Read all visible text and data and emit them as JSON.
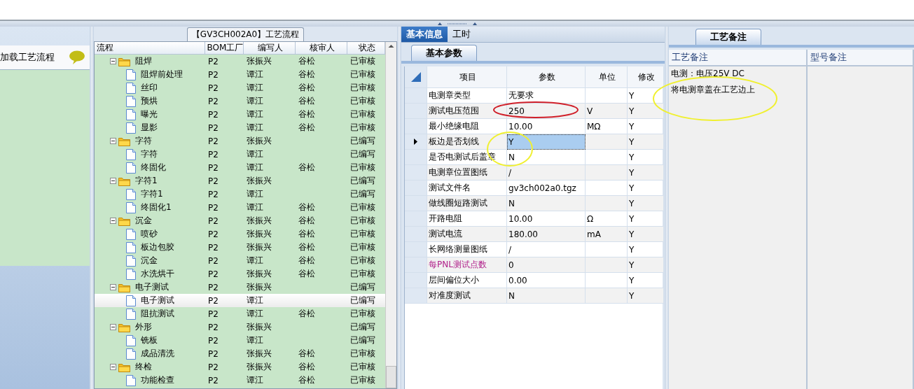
{
  "left_panel": {
    "item": "加载工艺流程"
  },
  "process_tree": {
    "title": "【GV3CH002A0】工艺流程",
    "columns": [
      "流程",
      "BOM工厂",
      "编写人",
      "核审人",
      "状态"
    ],
    "groups": [
      {
        "name": "阻焊",
        "bom": "P2",
        "author": "张振兴",
        "reviewer": "谷松",
        "status": "已审核",
        "expanded": true,
        "children": [
          {
            "name": "阻焊前处理",
            "bom": "P2",
            "author": "谭江",
            "reviewer": "谷松",
            "status": "已审核",
            "selected": false
          },
          {
            "name": "丝印",
            "bom": "P2",
            "author": "谭江",
            "reviewer": "谷松",
            "status": "已审核",
            "selected": false
          },
          {
            "name": "预烘",
            "bom": "P2",
            "author": "谭江",
            "reviewer": "谷松",
            "status": "已审核",
            "selected": false
          },
          {
            "name": "曝光",
            "bom": "P2",
            "author": "谭江",
            "reviewer": "谷松",
            "status": "已审核",
            "selected": false
          },
          {
            "name": "显影",
            "bom": "P2",
            "author": "谭江",
            "reviewer": "谷松",
            "status": "已审核",
            "selected": false
          }
        ]
      },
      {
        "name": "字符",
        "bom": "P2",
        "author": "张振兴",
        "status": "已编写",
        "expanded": true,
        "children": [
          {
            "name": "字符",
            "bom": "P2",
            "author": "谭江",
            "status": "已编写",
            "selected": false
          },
          {
            "name": "终固化",
            "bom": "P2",
            "author": "谭江",
            "reviewer": "谷松",
            "status": "已审核",
            "selected": false
          }
        ]
      },
      {
        "name": "字符1",
        "bom": "P2",
        "author": "张振兴",
        "status": "已编写",
        "expanded": true,
        "children": [
          {
            "name": "字符1",
            "bom": "P2",
            "author": "谭江",
            "status": "已编写",
            "selected": false
          },
          {
            "name": "终固化1",
            "bom": "P2",
            "author": "谭江",
            "reviewer": "谷松",
            "status": "已审核",
            "selected": false
          }
        ]
      },
      {
        "name": "沉金",
        "bom": "P2",
        "author": "张振兴",
        "reviewer": "谷松",
        "status": "已审核",
        "expanded": true,
        "children": [
          {
            "name": "喷砂",
            "bom": "P2",
            "author": "张振兴",
            "reviewer": "谷松",
            "status": "已审核",
            "selected": false
          },
          {
            "name": "板边包胶",
            "bom": "P2",
            "author": "张振兴",
            "reviewer": "谷松",
            "status": "已审核",
            "selected": false
          },
          {
            "name": "沉金",
            "bom": "P2",
            "author": "谭江",
            "reviewer": "谷松",
            "status": "已审核",
            "selected": false
          },
          {
            "name": "水洗烘干",
            "bom": "P2",
            "author": "张振兴",
            "reviewer": "谷松",
            "status": "已审核",
            "selected": false
          }
        ]
      },
      {
        "name": "电子测试",
        "bom": "P2",
        "author": "张振兴",
        "status": "已编写",
        "expanded": true,
        "children": [
          {
            "name": "电子测试",
            "bom": "P2",
            "author": "谭江",
            "status": "已编写",
            "selected": true
          },
          {
            "name": "阻抗测试",
            "bom": "P2",
            "author": "谭江",
            "reviewer": "谷松",
            "status": "已审核",
            "selected": false
          }
        ]
      },
      {
        "name": "外形",
        "bom": "P2",
        "author": "张振兴",
        "status": "已编写",
        "expanded": true,
        "children": [
          {
            "name": "铣板",
            "bom": "P2",
            "author": "谭江",
            "status": "已编写",
            "selected": false
          },
          {
            "name": "成品清洗",
            "bom": "P2",
            "author": "张振兴",
            "reviewer": "谷松",
            "status": "已审核",
            "selected": false
          }
        ]
      },
      {
        "name": "终检",
        "bom": "P2",
        "author": "张振兴",
        "reviewer": "谷松",
        "status": "已审核",
        "expanded": true,
        "children": [
          {
            "name": "功能检查",
            "bom": "P2",
            "author": "谭江",
            "reviewer": "谷松",
            "status": "已审核",
            "selected": false
          }
        ]
      }
    ]
  },
  "info_tabs": [
    {
      "label": "基本信息",
      "selected": true
    },
    {
      "label": "工时",
      "selected": false
    }
  ],
  "params": {
    "tab": "基本参数",
    "columns": [
      "项目",
      "参数",
      "单位",
      "修改"
    ],
    "rows": [
      {
        "item": "电测章类型",
        "value": "无要求",
        "modify": "Y",
        "selected": false,
        "flagged": false
      },
      {
        "item": "测试电压范围",
        "value": "250",
        "unit": "V",
        "modify": "Y",
        "selected": false,
        "flagged": false
      },
      {
        "item": "最小绝缘电阻",
        "value": "10.00",
        "unit": "MΩ",
        "modify": "Y",
        "selected": false,
        "flagged": false
      },
      {
        "item": "板边是否划线",
        "value": "Y",
        "modify": "Y",
        "selected": true,
        "flagged": false
      },
      {
        "item": "是否电测试后盖章",
        "value": "N",
        "modify": "Y",
        "selected": false,
        "flagged": false
      },
      {
        "item": "电测章位置图纸",
        "value": "/",
        "modify": "Y",
        "selected": false,
        "flagged": false
      },
      {
        "item": "测试文件名",
        "value": "gv3ch002a0.tgz",
        "modify": "Y",
        "selected": false,
        "flagged": false
      },
      {
        "item": "做线圈短路测试",
        "value": "N",
        "modify": "Y",
        "selected": false,
        "flagged": false
      },
      {
        "item": "开路电阻",
        "value": "10.00",
        "unit": "Ω",
        "modify": "Y",
        "selected": false,
        "flagged": false
      },
      {
        "item": "测试电流",
        "value": "180.00",
        "unit": "mA",
        "modify": "Y",
        "selected": false,
        "flagged": false
      },
      {
        "item": "长网络测量图纸",
        "value": "/",
        "modify": "Y",
        "selected": false,
        "flagged": false
      },
      {
        "item": "每PNL测试点数",
        "value": "0",
        "modify": "Y",
        "selected": false,
        "flagged": true
      },
      {
        "item": "层间偏位大小",
        "value": "0.00",
        "modify": "Y",
        "selected": false,
        "flagged": false
      },
      {
        "item": "对准度测试",
        "value": "N",
        "modify": "Y",
        "selected": false,
        "flagged": false
      }
    ]
  },
  "notes": {
    "tab": "工艺备注",
    "columns": [
      "工艺备注",
      "型号备注"
    ],
    "lines": [
      "电测：电压25V DC",
      "将电测章盖在工艺边上"
    ]
  },
  "annotations": [
    {
      "kind": "ellipse",
      "color": "#d0202a"
    },
    {
      "kind": "ellipse",
      "color": "#f0f030"
    },
    {
      "kind": "ellipse",
      "color": "#f0f030"
    }
  ]
}
